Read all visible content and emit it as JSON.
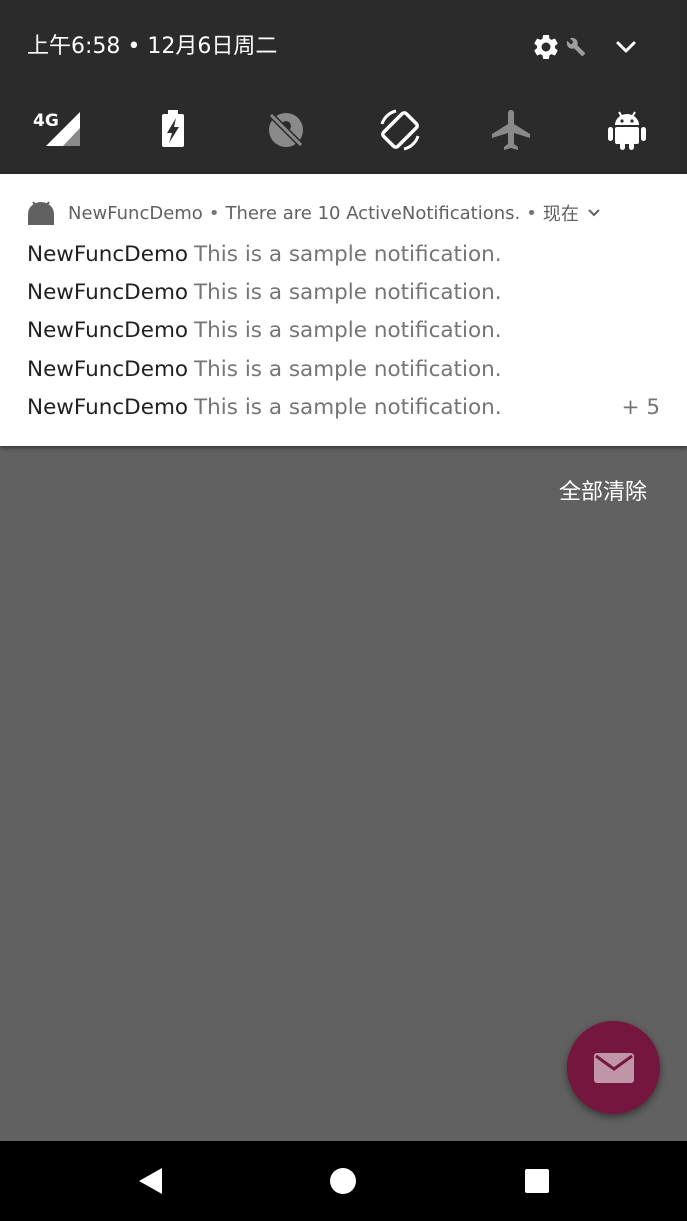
{
  "quick_settings": {
    "datetime": "上午6:58 • 12月6日周二",
    "header_icons": [
      "gear-icon",
      "wrench-icon",
      "chevron-down-icon"
    ],
    "tiles": [
      {
        "name": "mobile-data-4g-icon",
        "label": "4G"
      },
      {
        "name": "battery-saver-icon"
      },
      {
        "name": "location-off-icon"
      },
      {
        "name": "auto-rotate-icon"
      },
      {
        "name": "airplane-mode-icon"
      },
      {
        "name": "android-icon"
      }
    ]
  },
  "notification": {
    "app_icon": "android-head-icon",
    "app_name": "NewFuncDemo",
    "summary": "There are 10 ActiveNotifications.",
    "time": "现在",
    "lines": [
      {
        "title": "NewFuncDemo",
        "text": "This is a sample notification."
      },
      {
        "title": "NewFuncDemo",
        "text": "This is a sample notification."
      },
      {
        "title": "NewFuncDemo",
        "text": "This is a sample notification."
      },
      {
        "title": "NewFuncDemo",
        "text": "This is a sample notification."
      },
      {
        "title": "NewFuncDemo",
        "text": "This is a sample notification."
      }
    ],
    "more_count": "+ 5"
  },
  "clear_all_label": "全部清除",
  "fab": {
    "icon": "email-icon",
    "color": "#74163e"
  },
  "navigation": [
    "back-icon",
    "home-icon",
    "recents-icon"
  ],
  "colors": {
    "header_bg": "#2b2b2b",
    "scrim": "#616161",
    "card_bg": "#ffffff",
    "navbar_bg": "#000000"
  }
}
